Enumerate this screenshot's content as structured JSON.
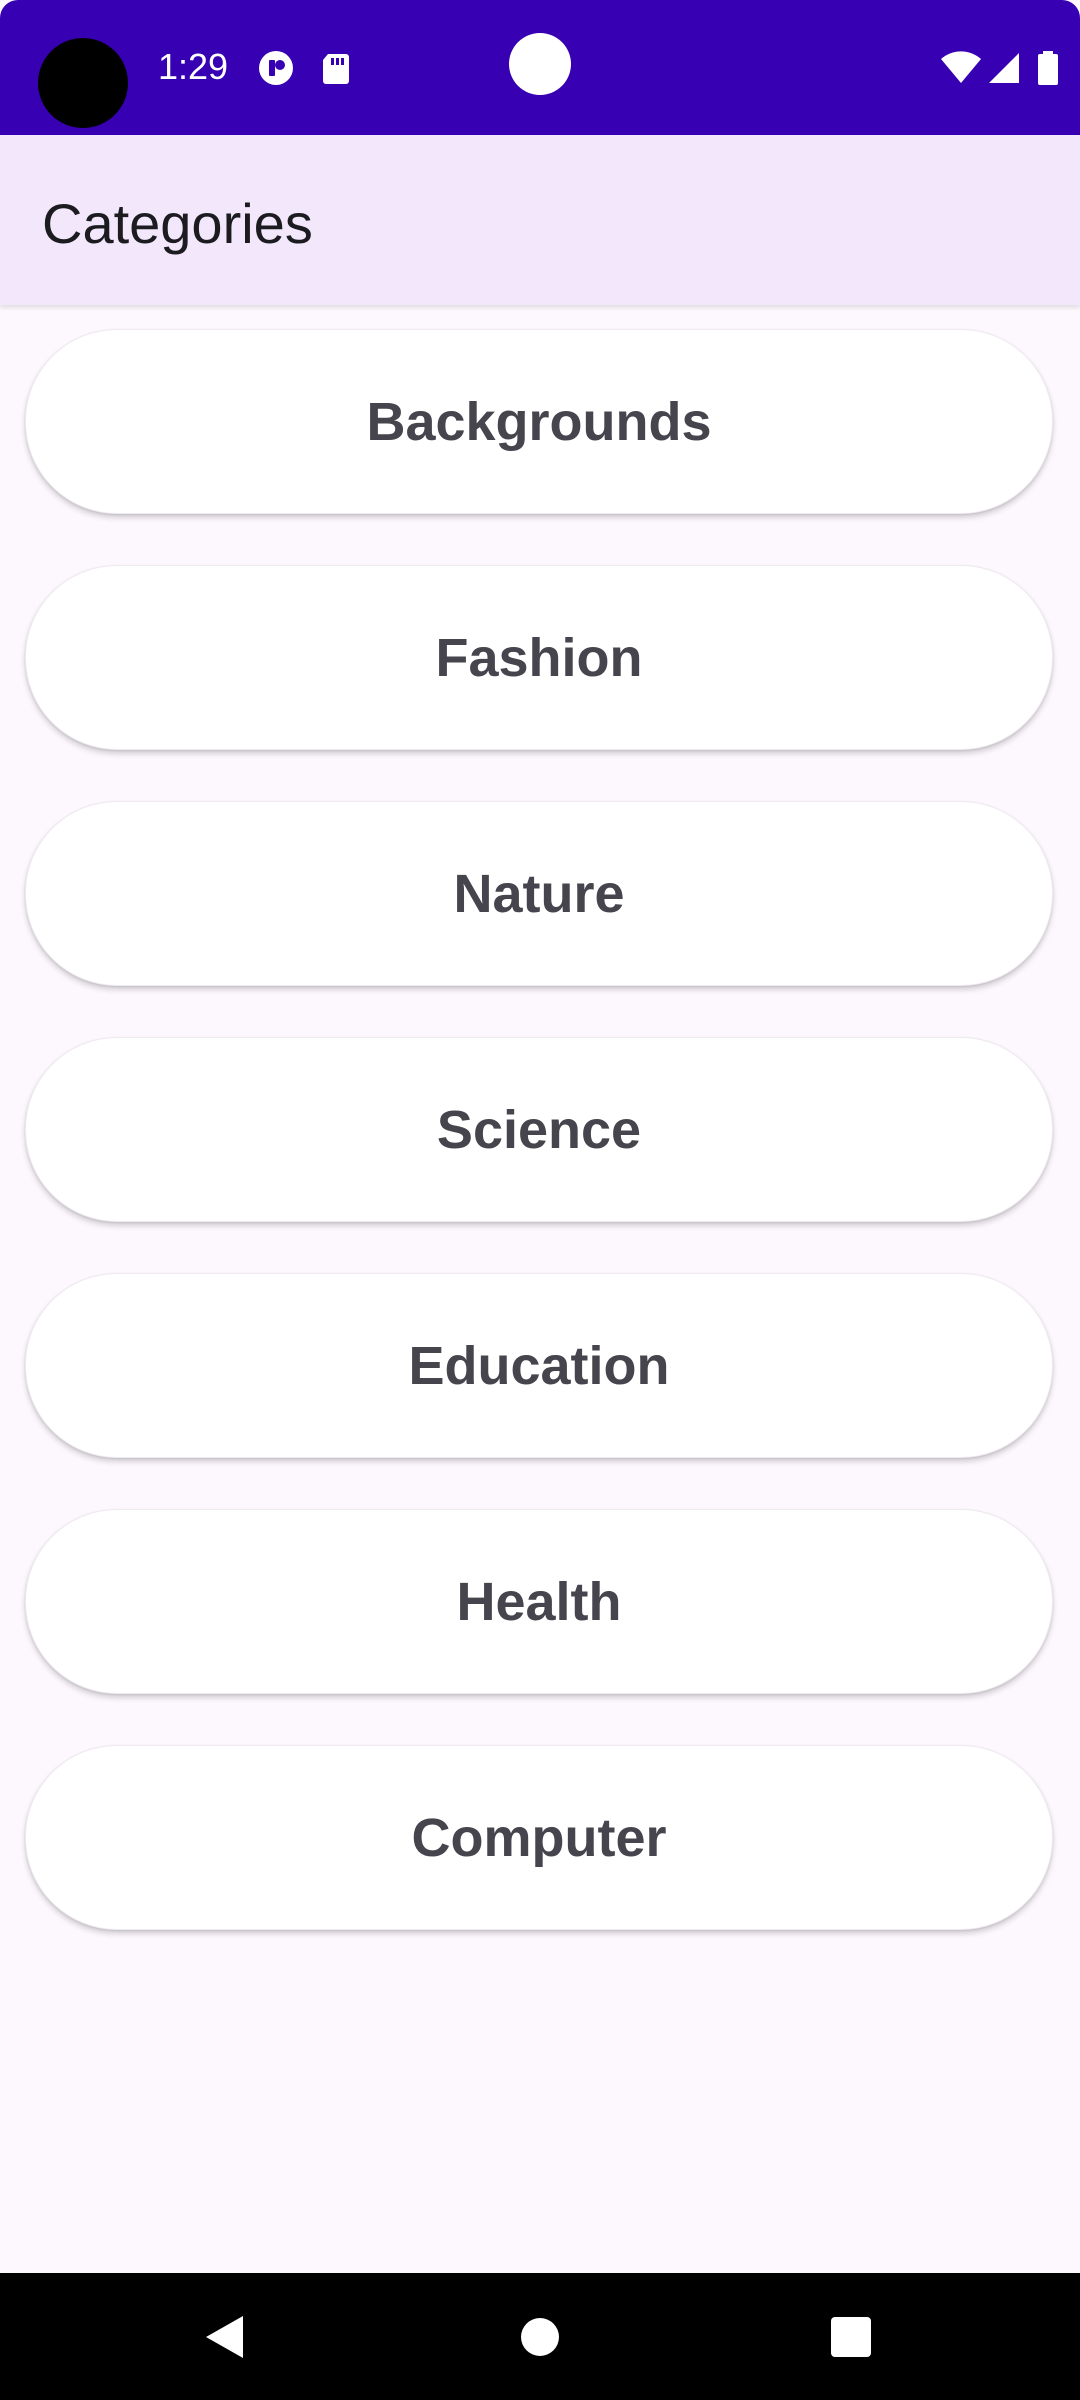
{
  "status_bar": {
    "time": "1:29",
    "icons": [
      "notification-app-icon",
      "sd-card-icon",
      "wifi-icon",
      "cellular-signal-icon",
      "battery-icon"
    ],
    "background_color": "#3700B3"
  },
  "app_bar": {
    "title": "Categories",
    "background_color": "#F2E7FB"
  },
  "categories": [
    {
      "label": "Backgrounds"
    },
    {
      "label": "Fashion"
    },
    {
      "label": "Nature"
    },
    {
      "label": "Science"
    },
    {
      "label": "Education"
    },
    {
      "label": "Health"
    },
    {
      "label": "Computer"
    }
  ],
  "nav_bar": {
    "buttons": [
      "back-icon",
      "home-icon",
      "recents-icon"
    ]
  },
  "colors": {
    "page_background": "#FDF8FD",
    "button_background": "#FFFFFF",
    "button_text": "#46444C"
  }
}
